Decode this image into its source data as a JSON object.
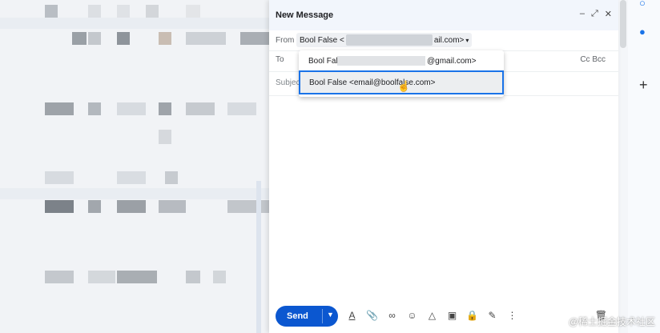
{
  "compose": {
    "title": "New Message",
    "header_icons": [
      "minimize-icon",
      "expand-icon",
      "close-icon"
    ],
    "from_label": "From",
    "from_name": "Bool False <",
    "from_domain": "ail.com>",
    "to_label": "To",
    "cc_bcc": "Cc Bcc",
    "subject_placeholder": "Subject"
  },
  "dropdown": {
    "option1_prefix": "Bool Fals",
    "option1_suffix": "@gmail.com>",
    "option2": "Bool False <email@boolfalse.com>"
  },
  "toolbar": {
    "send_label": "Send",
    "icons": [
      "format-text-icon",
      "attach-icon",
      "link-icon",
      "emoji-icon",
      "drive-icon",
      "photo-icon",
      "lock-icon",
      "signature-icon",
      "more-vert-icon"
    ]
  },
  "watermark": "@稀土掘金技术社区",
  "colors": {
    "accent": "#0b57d0",
    "highlight": "#1a73e8"
  }
}
